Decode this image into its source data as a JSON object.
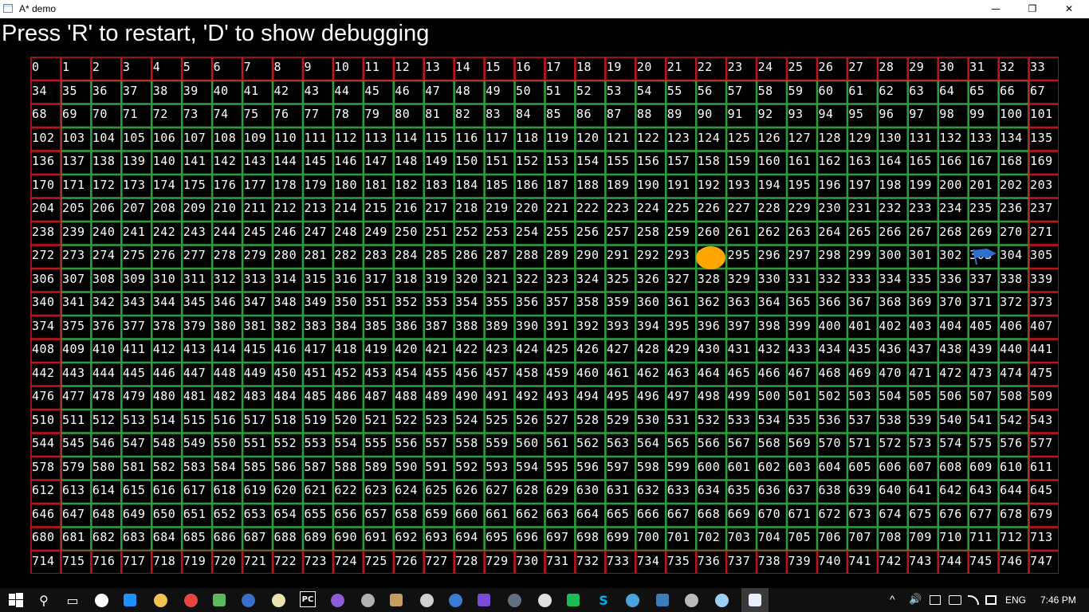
{
  "window": {
    "title": "A* demo",
    "minimize_glyph": "—",
    "maximize_glyph": "❐",
    "close_glyph": "✕"
  },
  "instructions": "Press 'R' to restart, 'D' to show debugging",
  "grid": {
    "columns": 34,
    "rows": 22,
    "wall_color": "#c0141c",
    "open_color": "#2c9c3c",
    "player_color": "#ffa500",
    "goal_color": "#2f6fd0",
    "player_cell": 294,
    "goal_cell": 303,
    "wall_cells": [
      0,
      1,
      2,
      3,
      4,
      5,
      6,
      7,
      8,
      9,
      10,
      11,
      12,
      13,
      14,
      15,
      16,
      17,
      18,
      19,
      20,
      21,
      22,
      23,
      24,
      25,
      26,
      27,
      28,
      29,
      30,
      31,
      32,
      33,
      34,
      67,
      68,
      101,
      102,
      135,
      136,
      169,
      170,
      203,
      204,
      237,
      238,
      271,
      272,
      305,
      306,
      339,
      340,
      373,
      374,
      407,
      408,
      441,
      442,
      475,
      476,
      509,
      510,
      543,
      544,
      577,
      578,
      611,
      612,
      645,
      646,
      679,
      680,
      713,
      714,
      715,
      716,
      717,
      718,
      719,
      720,
      721,
      722,
      723,
      724,
      725,
      726,
      727,
      728,
      729,
      730,
      731,
      732,
      733,
      734,
      735,
      736,
      737,
      738,
      739,
      740,
      741,
      742,
      743,
      744,
      745,
      746,
      747
    ]
  },
  "taskbar": {
    "start_icon": "windows-logo-icon",
    "apps": [
      {
        "name": "search-icon",
        "glyph": "⚲",
        "color": "#ffffff"
      },
      {
        "name": "task-view-icon",
        "glyph": "▭",
        "color": "#ffffff"
      },
      {
        "name": "store-icon",
        "glyph": "",
        "color": "#ffffff"
      },
      {
        "name": "edge-icon",
        "glyph": "",
        "color": "#1e90ff"
      },
      {
        "name": "file-explorer-icon",
        "glyph": "",
        "color": "#f2c14e"
      },
      {
        "name": "chrome-icon",
        "glyph": "",
        "color": "#e8453c"
      },
      {
        "name": "git-globe-icon",
        "glyph": "",
        "color": "#5cb85c"
      },
      {
        "name": "visual-studio-code-icon",
        "glyph": "",
        "color": "#3b6ec8"
      },
      {
        "name": "notepad-icon",
        "glyph": "",
        "color": "#e9e2b0"
      },
      {
        "name": "pycharm-icon",
        "glyph": "PC",
        "color": "#000000"
      },
      {
        "name": "visual-studio-icon",
        "glyph": "",
        "color": "#8e5ad6"
      },
      {
        "name": "generic-app-icon",
        "glyph": "",
        "color": "#b0b0b0"
      },
      {
        "name": "terminal-icon",
        "glyph": "",
        "color": "#c0a060"
      },
      {
        "name": "unity-icon",
        "glyph": "",
        "color": "#d0d0d0"
      },
      {
        "name": "powershell-icon",
        "glyph": "",
        "color": "#3a7bd5"
      },
      {
        "name": "media-player-icon",
        "glyph": "",
        "color": "#7b4bd6"
      },
      {
        "name": "app-circle-icon",
        "glyph": "",
        "color": "#607080"
      },
      {
        "name": "github-icon",
        "glyph": "",
        "color": "#e0e0e0"
      },
      {
        "name": "spotify-icon",
        "glyph": "",
        "color": "#1db954"
      },
      {
        "name": "skype-icon",
        "glyph": "S",
        "color": "#00aff0"
      },
      {
        "name": "ide-icon",
        "glyph": "",
        "color": "#4aa3df"
      },
      {
        "name": "steam-icon",
        "glyph": "",
        "color": "#3d7bbd"
      },
      {
        "name": "app-arrow-icon",
        "glyph": "",
        "color": "#bbbbbb"
      },
      {
        "name": "settings-app-icon",
        "glyph": "",
        "color": "#9ad0f5"
      },
      {
        "name": "active-window-icon",
        "glyph": "",
        "color": "#e8f0ff"
      }
    ],
    "tray": {
      "show_hidden_glyph": "^",
      "volume_glyph": "🔊",
      "language": "ENG",
      "time": "7:46 PM"
    }
  }
}
